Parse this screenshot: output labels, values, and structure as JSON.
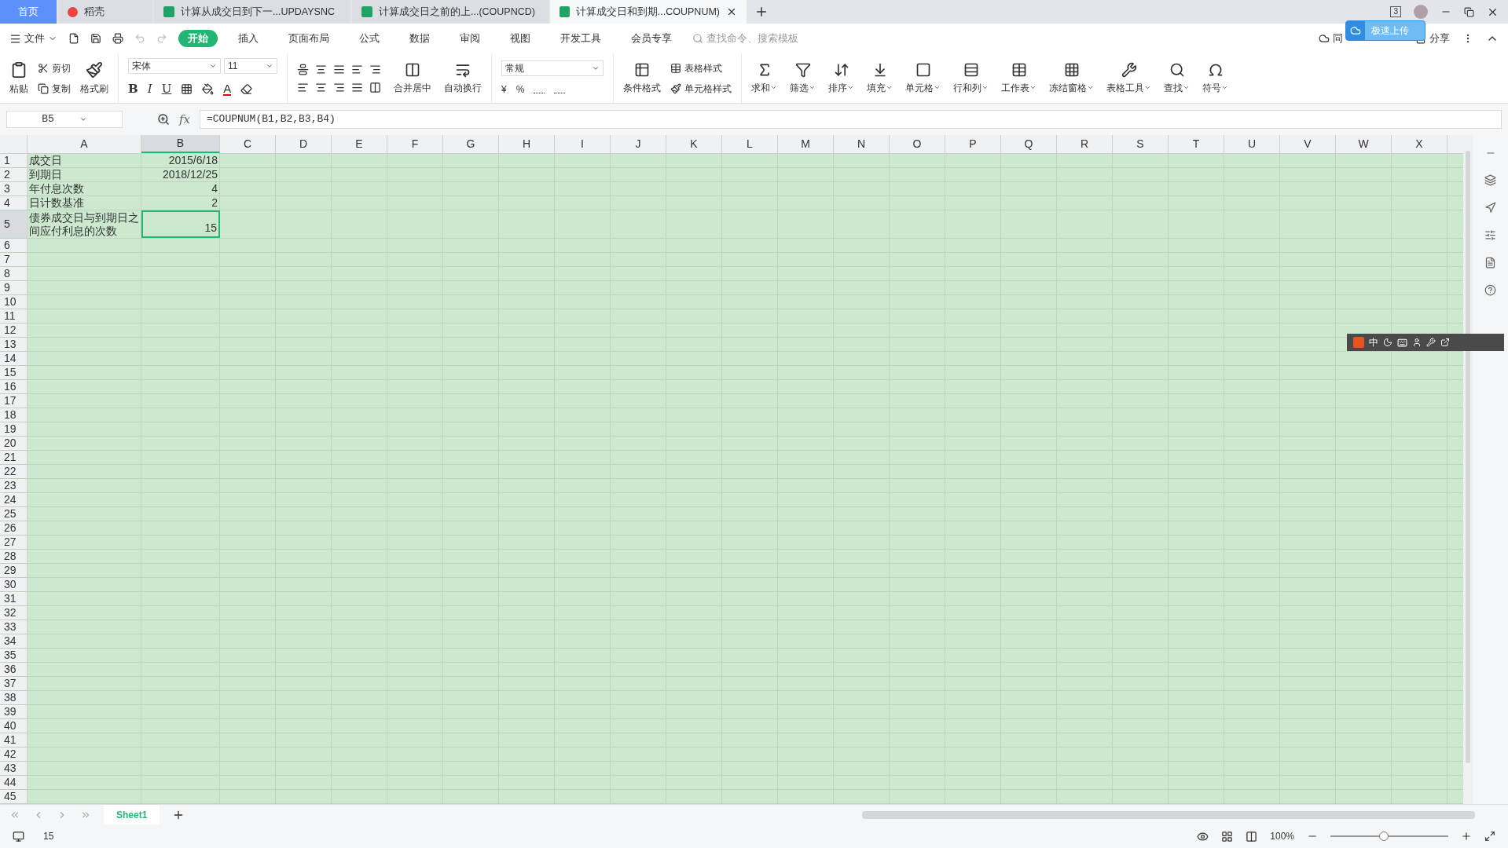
{
  "title_tabs": [
    {
      "label": "首页",
      "kind": "home",
      "selected": false
    },
    {
      "label": "稻壳",
      "kind": "docer",
      "selected": false
    },
    {
      "label": "计算从成交日到下一...UPDAYSNC",
      "kind": "sheet",
      "selected": false
    },
    {
      "label": "计算成交日之前的上...(COUPNCD)",
      "kind": "sheet",
      "selected": false
    },
    {
      "label": "计算成交日和到期...COUPNUM)",
      "kind": "sheet",
      "selected": true
    }
  ],
  "window_badge": "3",
  "menu": {
    "file": "文件",
    "tabs": [
      {
        "label": "开始",
        "selected": true
      },
      {
        "label": "插入",
        "selected": false
      },
      {
        "label": "页面布局",
        "selected": false
      },
      {
        "label": "公式",
        "selected": false
      },
      {
        "label": "数据",
        "selected": false
      },
      {
        "label": "审阅",
        "selected": false
      },
      {
        "label": "视图",
        "selected": false
      },
      {
        "label": "开发工具",
        "selected": false
      },
      {
        "label": "会员专享",
        "selected": false
      }
    ],
    "search_placeholder": "查找命令、搜索模板",
    "sync": "同",
    "share": "分享"
  },
  "upload_popup": {
    "label": "极速上传"
  },
  "ribbon": {
    "paste": "粘贴",
    "cut": "剪切",
    "copy": "复制",
    "format_painter": "格式刷",
    "font": "宋体",
    "size": "11",
    "font_styles": [
      "B",
      "I",
      "U"
    ],
    "font_color": "A",
    "number_format": "常规",
    "currency": "¥",
    "percent": "%",
    "merge": "合并居中",
    "wrap": "自动换行",
    "conditional": "条件格式",
    "table_style": "表格样式",
    "cell_style": "单元格样式",
    "tools": [
      {
        "label": "求和"
      },
      {
        "label": "筛选"
      },
      {
        "label": "排序"
      },
      {
        "label": "填充"
      },
      {
        "label": "单元格"
      },
      {
        "label": "行和列"
      },
      {
        "label": "工作表"
      },
      {
        "label": "冻结窗格"
      },
      {
        "label": "表格工具"
      },
      {
        "label": "查找"
      },
      {
        "label": "符号"
      }
    ]
  },
  "formula_bar": {
    "name_box": "B5",
    "fx": "fx",
    "formula": "=COUPNUM(B1,B2,B3,B4)"
  },
  "columns": [
    {
      "label": "A",
      "selected": false
    },
    {
      "label": "B",
      "selected": true
    },
    {
      "label": "C",
      "selected": false
    },
    {
      "label": "D",
      "selected": false
    },
    {
      "label": "E",
      "selected": false
    },
    {
      "label": "F",
      "selected": false
    },
    {
      "label": "G",
      "selected": false
    },
    {
      "label": "H",
      "selected": false
    },
    {
      "label": "I",
      "selected": false
    },
    {
      "label": "J",
      "selected": false
    },
    {
      "label": "K",
      "selected": false
    },
    {
      "label": "L",
      "selected": false
    },
    {
      "label": "M",
      "selected": false
    },
    {
      "label": "N",
      "selected": false
    },
    {
      "label": "O",
      "selected": false
    },
    {
      "label": "P",
      "selected": false
    },
    {
      "label": "Q",
      "selected": false
    },
    {
      "label": "R",
      "selected": false
    },
    {
      "label": "S",
      "selected": false
    },
    {
      "label": "T",
      "selected": false
    },
    {
      "label": "U",
      "selected": false
    },
    {
      "label": "V",
      "selected": false
    },
    {
      "label": "W",
      "selected": false
    },
    {
      "label": "X",
      "selected": false
    }
  ],
  "rows": [
    {
      "number": "1",
      "selected": false,
      "cells": [
        "成交日",
        "2015/6/18"
      ]
    },
    {
      "number": "2",
      "selected": false,
      "cells": [
        "到期日",
        "2018/12/25"
      ]
    },
    {
      "number": "3",
      "selected": false,
      "cells": [
        "年付息次数",
        "4"
      ]
    },
    {
      "number": "4",
      "selected": false,
      "cells": [
        "日计数基准",
        "2"
      ]
    },
    {
      "number": "5",
      "selected": true,
      "tall": true,
      "cells": [
        "债券成交日与到期日之间应付利息的次数",
        "15"
      ]
    },
    {
      "number": "6",
      "selected": false
    },
    {
      "number": "7",
      "selected": false
    },
    {
      "number": "8",
      "selected": false
    },
    {
      "number": "9",
      "selected": false
    },
    {
      "number": "10",
      "selected": false
    },
    {
      "number": "11",
      "selected": false
    },
    {
      "number": "12",
      "selected": false
    },
    {
      "number": "13",
      "selected": false
    },
    {
      "number": "14",
      "selected": false
    },
    {
      "number": "15",
      "selected": false
    },
    {
      "number": "16",
      "selected": false
    },
    {
      "number": "17",
      "selected": false
    },
    {
      "number": "18",
      "selected": false
    },
    {
      "number": "19",
      "selected": false
    },
    {
      "number": "20",
      "selected": false
    },
    {
      "number": "21",
      "selected": false
    },
    {
      "number": "22",
      "selected": false
    },
    {
      "number": "23",
      "selected": false
    },
    {
      "number": "24",
      "selected": false
    },
    {
      "number": "25",
      "selected": false
    },
    {
      "number": "26",
      "selected": false
    },
    {
      "number": "27",
      "selected": false
    },
    {
      "number": "28",
      "selected": false
    },
    {
      "number": "29",
      "selected": false
    },
    {
      "number": "30",
      "selected": false
    },
    {
      "number": "31",
      "selected": false
    },
    {
      "number": "32",
      "selected": false
    },
    {
      "number": "33",
      "selected": false
    },
    {
      "number": "34",
      "selected": false
    },
    {
      "number": "35",
      "selected": false
    },
    {
      "number": "36",
      "selected": false
    },
    {
      "number": "37",
      "selected": false
    },
    {
      "number": "38",
      "selected": false
    },
    {
      "number": "39",
      "selected": false
    },
    {
      "number": "40",
      "selected": false
    },
    {
      "number": "41",
      "selected": false
    },
    {
      "number": "42",
      "selected": false
    },
    {
      "number": "43",
      "selected": false
    },
    {
      "number": "44",
      "selected": false
    },
    {
      "number": "45",
      "selected": false
    }
  ],
  "sheet_tabs": [
    {
      "label": "Sheet1",
      "selected": true
    }
  ],
  "ime_toolbar": {
    "mode": "中"
  },
  "status_bar": {
    "value": "15",
    "zoom": "100%",
    "zoom_slider": {
      "level": 0.45
    }
  }
}
